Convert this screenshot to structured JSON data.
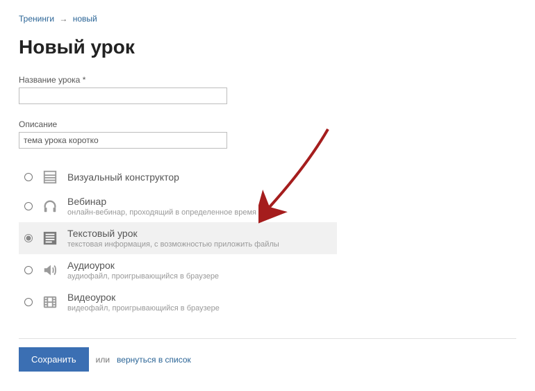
{
  "breadcrumb": {
    "item0": "Тренинги",
    "separator": "→",
    "item1": "новый"
  },
  "page_title": "Новый урок",
  "fields": {
    "name_label": "Название урока *",
    "name_value": "",
    "desc_label": "Описание",
    "desc_value": "тема урока коротко"
  },
  "lesson_types": {
    "visual": {
      "title": "Визуальный конструктор",
      "sub": ""
    },
    "webinar": {
      "title": "Вебинар",
      "sub": "онлайн-вебинар, проходящий в определенное время"
    },
    "text": {
      "title": "Текстовый урок",
      "sub": "текстовая информация, с возможностью приложить файлы"
    },
    "audio": {
      "title": "Аудиоурок",
      "sub": "аудиофайл, проигрывающийся в браузере"
    },
    "video": {
      "title": "Видеоурок",
      "sub": "видеофайл, проигрывающийся в браузере"
    }
  },
  "footer": {
    "save": "Сохранить",
    "or": "или",
    "back": "вернуться в список"
  },
  "colors": {
    "accent": "#3b6fb3",
    "link": "#2a6496",
    "arrow": "#a51d1d"
  }
}
